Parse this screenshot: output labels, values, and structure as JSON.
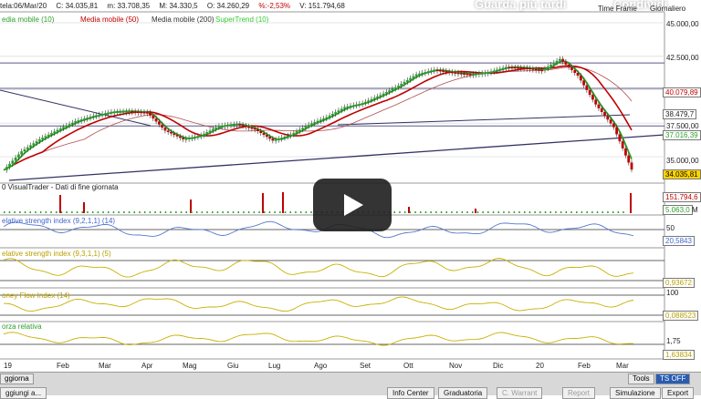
{
  "header": {
    "date": "tela:06/Mar/20",
    "close": "C: 34.035,81",
    "min": "m: 33.708,35",
    "max": "M: 34.330,5",
    "open": "O: 34.260,29",
    "change": "%:-2,53%",
    "volume": "V: 151.794,68"
  },
  "legend": [
    {
      "label": "edia mobile (10)",
      "color": "#2ca02c"
    },
    {
      "label": "Media mobile (50)",
      "color": "#c00000"
    },
    {
      "label": "Media mobile (200)",
      "color": "#333333"
    },
    {
      "label": "SuperTrend (10)",
      "color": "#33cc33"
    }
  ],
  "overlay": {
    "watch_later": "Guarda più tardi",
    "share": "Condividi"
  },
  "top_right": {
    "time_frame": "Time Frame",
    "mode": "Giornaliero"
  },
  "price_axis": [
    "45.000,00",
    "42.500,00",
    "40.079,89",
    "38.479,7",
    "37.500,00",
    "37.016,39",
    "35.000,00",
    "34.035,81"
  ],
  "volume": {
    "title": "0 VisualTrader - Dati di fine giornata",
    "max_label": "151.794,6",
    "last_label": "5.063,0",
    "m_tag": "M"
  },
  "rsi": {
    "title": "elative strength index (9,2,1,1) (14)",
    "level": "50",
    "value": "20,5843"
  },
  "rsi2": {
    "title": "elative strength index (9,3,1,1) (5)",
    "value": "0,93672"
  },
  "mfi": {
    "title": "oney Flow Index (14)",
    "level": "100",
    "value": "0,088523"
  },
  "forza": {
    "title": "orza relativa",
    "level": "1,75",
    "value": "1,63834"
  },
  "months": [
    "19",
    "Feb",
    "Mar",
    "Apr",
    "Mag",
    "Giu",
    "Lug",
    "Ago",
    "Set",
    "Ott",
    "Nov",
    "Dic",
    "20",
    "Feb",
    "Mar"
  ],
  "tabs": {
    "left": "ggiorna",
    "tools": "Tools",
    "ts_off": "TS OFF"
  },
  "buttons": {
    "add": "ggiungi a...",
    "info": "Info Center",
    "grad": "Graduatoria",
    "warrant": "C. Warrant",
    "report": "Report",
    "sim": "Simulazione",
    "export": "Export"
  },
  "chart_data": {
    "type": "candlestick",
    "yaxis_ticks": [
      "35.000,00",
      "37.500,00",
      "40.079,89",
      "42.500,00",
      "45.000,00"
    ],
    "ylim": [
      33000,
      45500
    ],
    "x_labels": [
      "19",
      "Feb",
      "Mar",
      "Apr",
      "Mag",
      "Giu",
      "Lug",
      "Ago",
      "Set",
      "Ott",
      "Nov",
      "Dic",
      "20",
      "Feb",
      "Mar"
    ],
    "close_series": [
      34000,
      35400,
      36300,
      37000,
      37650,
      38050,
      38350,
      38400,
      38300,
      36950,
      36300,
      36600,
      37300,
      37450,
      37050,
      36200,
      36650,
      37400,
      37950,
      38700,
      39000,
      39600,
      40300,
      41150,
      41500,
      41300,
      41150,
      41300,
      41700,
      41650,
      41450,
      42300,
      41050,
      38900,
      37200,
      34035
    ],
    "last_close": 34035.81,
    "change_pct": -2.53,
    "volume_last": 151794.68,
    "indicators": [
      "edia mobile (10)",
      "Media mobile (50)",
      "Media mobile (200)",
      "SuperTrend (10)"
    ]
  }
}
